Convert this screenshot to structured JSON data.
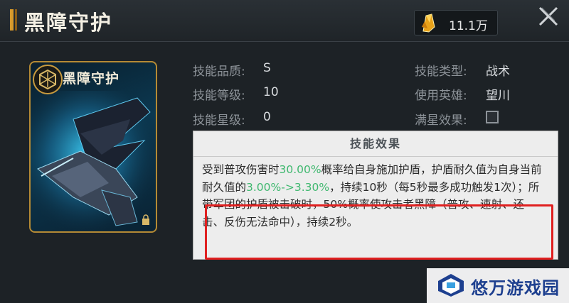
{
  "header": {
    "title": "黑障守护",
    "currency_icon": "yellow-crystal-icon",
    "currency_value": "11.1万",
    "close_icon": "close-icon"
  },
  "card": {
    "title": "黑障守护",
    "emblem_icon": "hexagon-emblem-icon",
    "art": "dark-feathered-creature-illustration"
  },
  "stats": {
    "quality_label": "技能品质:",
    "quality_value": "S",
    "level_label": "技能等级:",
    "level_value": "10",
    "star_label": "技能星级:",
    "star_value": "0",
    "type_label": "技能类型:",
    "type_value": "战术",
    "hero_label": "使用英雄:",
    "hero_value": "望川",
    "fullstar_label": "满星效果:"
  },
  "effect": {
    "header": "技能效果",
    "t1": "受到普攻伤害时",
    "t2": "30.00%",
    "t3": "概率给自身施加护盾，护盾耐久值为自身当前耐久值的",
    "t4": "3.00%->3.30%",
    "t5": "，持续10秒（每5秒最多成功触发1次）；所带军团的护盾被击破时，50%概率使攻击者黑障（普攻、速射、还击、反伤无法命中），持续2秒。",
    "highlight_color": "#3fb86f"
  },
  "watermark": {
    "text": "悠万游戏园"
  }
}
